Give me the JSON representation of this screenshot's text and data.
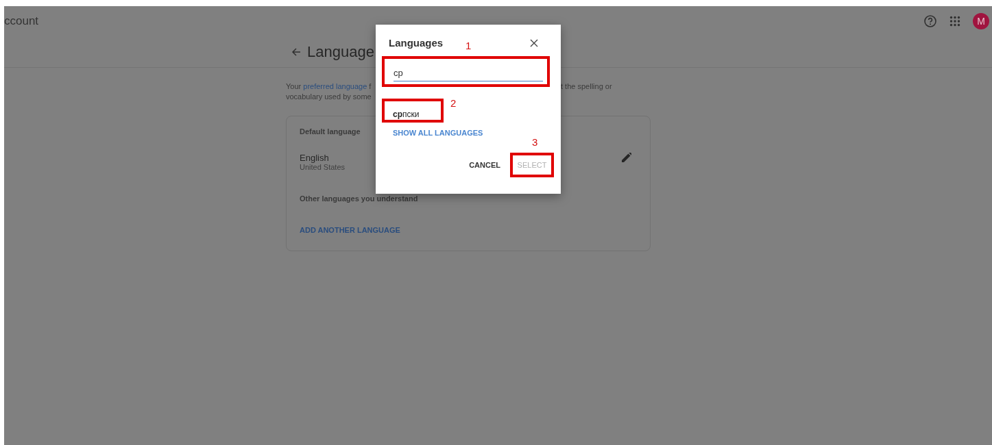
{
  "header": {
    "title": "ccount",
    "avatar": "M"
  },
  "page": {
    "title": "Language",
    "intro_start": "Your ",
    "intro_link": "preferred language",
    "intro_cut": " f",
    "intro_end": "t the spelling or",
    "intro_line_2": "vocabulary used by some"
  },
  "card": {
    "default_label": "Default language",
    "language": "English",
    "region": "United States",
    "other_label": "Other languages you understand",
    "add_button": "ADD ANOTHER LANGUAGE"
  },
  "dialog": {
    "title": "Languages",
    "search": {
      "value": "ср",
      "annotation": "1"
    },
    "results": [
      {
        "label": "**ср**пски",
        "annotation": "2"
      }
    ],
    "show_all": "SHOW ALL LANGUAGES",
    "buttons": [
      {
        "label": "CANCEL",
        "disabled": false
      },
      {
        "label": "SELECT",
        "disabled": true,
        "annotation": "3"
      }
    ]
  }
}
